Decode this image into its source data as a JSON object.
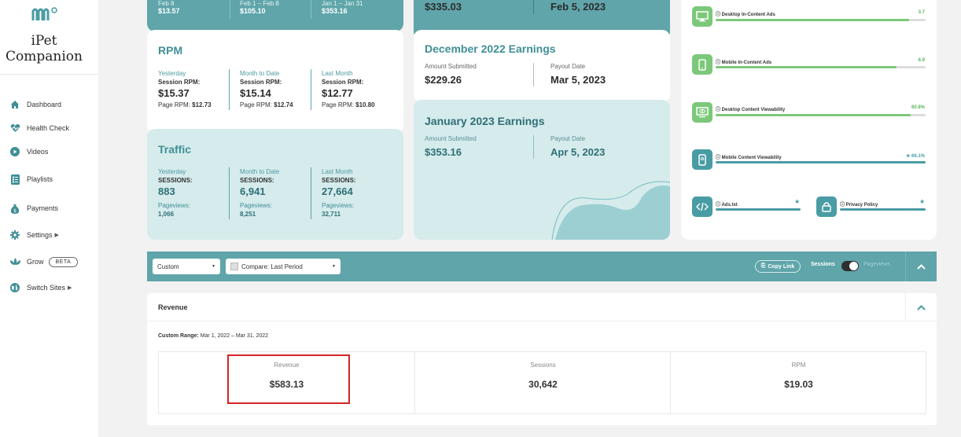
{
  "brand": {
    "name_line1": "iPet",
    "name_line2": "Companion"
  },
  "sidebar": {
    "items": [
      {
        "label": "Dashboard"
      },
      {
        "label": "Health Check"
      },
      {
        "label": "Videos"
      },
      {
        "label": "Playlists"
      },
      {
        "label": "Payments"
      },
      {
        "label": "Settings"
      },
      {
        "label": "Grow",
        "badge": "BETA"
      },
      {
        "label": "Switch Sites"
      }
    ]
  },
  "top_strip": {
    "cols": [
      {
        "label": "Feb 8",
        "value": "$13.57"
      },
      {
        "label": "Feb 1 – Feb 8",
        "value": "$105.10"
      },
      {
        "label": "Jan 1 – Jan 31",
        "value": "$353.16"
      }
    ]
  },
  "prev_earnings": {
    "amount": "$335.03",
    "date": "Feb 5, 2023"
  },
  "rpm": {
    "title": "RPM",
    "cols": [
      {
        "label": "Yesterday",
        "sub": "Session RPM:",
        "value": "$15.37",
        "page_label": "Page RPM:",
        "page_value": "$12.73"
      },
      {
        "label": "Month to Date",
        "sub": "Session RPM:",
        "value": "$15.14",
        "page_label": "Page RPM:",
        "page_value": "$12.74"
      },
      {
        "label": "Last Month",
        "sub": "Session RPM:",
        "value": "$12.77",
        "page_label": "Page RPM:",
        "page_value": "$10.80"
      }
    ]
  },
  "traffic": {
    "title": "Traffic",
    "cols": [
      {
        "label": "Yesterday",
        "sub": "SESSIONS:",
        "value": "883",
        "pv_label": "Pageviews:",
        "pv_value": "1,066"
      },
      {
        "label": "Month to Date",
        "sub": "SESSIONS:",
        "value": "6,941",
        "pv_label": "Pageviews:",
        "pv_value": "8,251"
      },
      {
        "label": "Last Month",
        "sub": "SESSIONS:",
        "value": "27,664",
        "pv_label": "Pageviews:",
        "pv_value": "32,711"
      }
    ]
  },
  "dec_earnings": {
    "title": "December 2022 Earnings",
    "amount_label": "Amount Submitted",
    "amount": "$229.26",
    "date_label": "Payout Date",
    "date": "Mar 5, 2023"
  },
  "jan_earnings": {
    "title": "January 2023 Earnings",
    "amount_label": "Amount Submitted",
    "amount": "$353.16",
    "date_label": "Payout Date",
    "date": "Apr 5, 2023"
  },
  "health": {
    "metrics": [
      {
        "label": "Desktop In-Content Ads",
        "value": "3.7",
        "fill": 0.92,
        "color": "#7cc87a"
      },
      {
        "label": "Mobile In-Content Ads",
        "value": "6.9",
        "fill": 0.86,
        "color": "#7cc87a"
      },
      {
        "label": "Desktop Content Viewability",
        "value": "60.8%",
        "fill": 0.93,
        "color": "#7cc87a"
      },
      {
        "label": "Mobile Content Viewability",
        "value": "66.1%",
        "fill": 1.0,
        "color": "#4a9ca4"
      }
    ],
    "ads_txt": "Ads.txt",
    "privacy": "Privacy Policy"
  },
  "toolbar": {
    "range_select": "Custom",
    "compare_select": "Compare: Last Period",
    "copy_link": "Copy Link",
    "sessions": "Sessions",
    "pageviews": "Pageviews"
  },
  "revenue": {
    "title": "Revenue",
    "range_label": "Custom Range:",
    "range_value": "Mar 1, 2022 – Mar 31, 2022",
    "stats": [
      {
        "label": "Revenue",
        "value": "$583.13"
      },
      {
        "label": "Sessions",
        "value": "30,642"
      },
      {
        "label": "RPM",
        "value": "$19.03"
      }
    ]
  },
  "colors": {
    "teal": "#5fa5aa",
    "light_teal": "#d5ebec",
    "green": "#7cc87a",
    "highlight": "#d32424"
  }
}
